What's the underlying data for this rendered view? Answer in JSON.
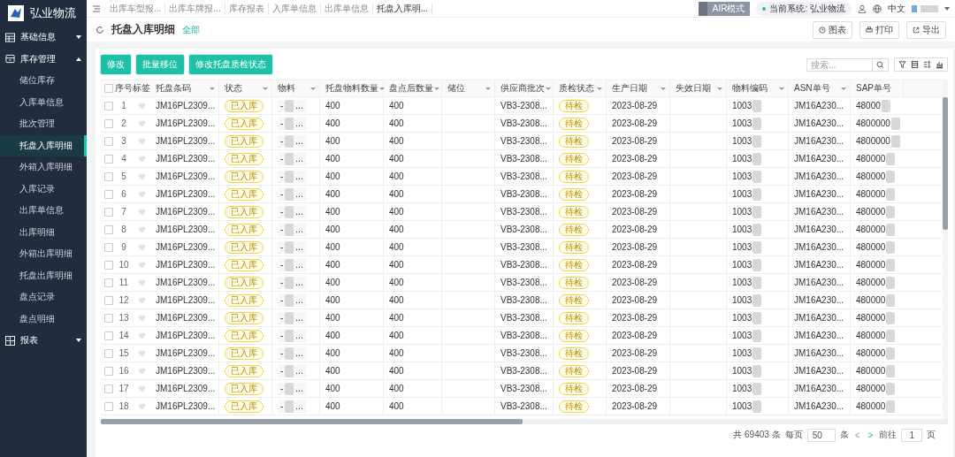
{
  "logo": {
    "title": "弘业物流"
  },
  "sidebar": {
    "groups": [
      {
        "label": "基础信息",
        "expanded": false
      },
      {
        "label": "库存管理",
        "expanded": true,
        "children": [
          {
            "label": "储位库存",
            "selected": false
          },
          {
            "label": "入库单信息",
            "selected": false
          },
          {
            "label": "批次管理",
            "selected": false
          },
          {
            "label": "托盘入库明细",
            "selected": true
          },
          {
            "label": "外箱入库明细",
            "selected": false
          },
          {
            "label": "入库记录",
            "selected": false
          },
          {
            "label": "出库单信息",
            "selected": false
          },
          {
            "label": "出库明细",
            "selected": false
          },
          {
            "label": "外箱出库明细",
            "selected": false
          },
          {
            "label": "托盘出库明细",
            "selected": false
          },
          {
            "label": "盘点记录",
            "selected": false
          },
          {
            "label": "盘点明细",
            "selected": false
          }
        ]
      },
      {
        "label": "报表",
        "expanded": false
      }
    ]
  },
  "tabs": [
    {
      "label": "出库车型报...",
      "selected": false
    },
    {
      "label": "出库车牌报...",
      "selected": false
    },
    {
      "label": "库存报表",
      "selected": false
    },
    {
      "label": "入库单信息",
      "selected": false
    },
    {
      "label": "出库单信息",
      "selected": false
    },
    {
      "label": "托盘入库明...",
      "selected": true
    }
  ],
  "topbar": {
    "mode": "AIR模式",
    "mode_on": false,
    "system": "当前系统: 弘业物流",
    "language": "中文"
  },
  "page": {
    "title": "托盘入库明细",
    "filter": "全部",
    "actions": [
      "图表",
      "打印",
      "导出"
    ]
  },
  "toolbar": {
    "buttons": [
      "修改",
      "批量移位",
      "修改托盘质检状态"
    ],
    "search": {
      "placeholder": "搜索..."
    }
  },
  "table": {
    "select_all": {
      "checked": false
    },
    "columns": [
      {
        "label": "序号",
        "dropdown": false
      },
      {
        "label": "标签",
        "dropdown": false
      },
      {
        "label": "托盘条码",
        "dropdown": true
      },
      {
        "label": "状态",
        "dropdown": true
      },
      {
        "label": "物料",
        "dropdown": true
      },
      {
        "label": "托盘物料数量",
        "dropdown": true
      },
      {
        "label": "盘点后数量",
        "dropdown": true
      },
      {
        "label": "储位",
        "dropdown": true
      },
      {
        "label": "供应商批次",
        "dropdown": true
      },
      {
        "label": "质检状态",
        "dropdown": true
      },
      {
        "label": "生产日期",
        "dropdown": true
      },
      {
        "label": "失效日期",
        "dropdown": true
      },
      {
        "label": "物料编码",
        "dropdown": true
      },
      {
        "label": "ASN单号",
        "dropdown": true
      },
      {
        "label": "SAP单号",
        "dropdown": false
      }
    ],
    "rows": [
      {
        "checked": false,
        "no": "1",
        "pallet": "JM16PL2309...",
        "status": "已入库",
        "material": "-",
        "material_tail": "...",
        "qty": "400",
        "counted": "400",
        "batch": "VB3-2308...",
        "qc": "待检",
        "date": "2023-08-29",
        "code": "1003",
        "asn": "JM16A230...",
        "sap": "48000"
      },
      {
        "checked": false,
        "no": "2",
        "pallet": "JM16PL2309...",
        "status": "已入库",
        "material": "-",
        "material_tail": "...",
        "qty": "400",
        "counted": "400",
        "batch": "VB3-2308...",
        "qc": "待检",
        "date": "2023-08-29",
        "code": "1003",
        "asn": "JM16A230...",
        "sap": "4800000"
      },
      {
        "checked": false,
        "no": "3",
        "pallet": "JM16PL2309...",
        "status": "已入库",
        "material": "-",
        "material_tail": "...",
        "qty": "400",
        "counted": "400",
        "batch": "VB3-2308...",
        "qc": "待检",
        "date": "2023-08-29",
        "code": "1003",
        "asn": "JM16A230...",
        "sap": "4800000"
      },
      {
        "checked": false,
        "no": "4",
        "pallet": "JM16PL2309...",
        "status": "已入库",
        "material": "-",
        "material_tail": "...",
        "qty": "400",
        "counted": "400",
        "batch": "VB3-2308...",
        "qc": "待检",
        "date": "2023-08-29",
        "code": "1003",
        "asn": "JM16A230...",
        "sap": "480000"
      },
      {
        "checked": false,
        "no": "5",
        "pallet": "JM16PL2309...",
        "status": "已入库",
        "material": "-",
        "material_tail": "...",
        "qty": "400",
        "counted": "400",
        "batch": "VB3-2308...",
        "qc": "待检",
        "date": "2023-08-29",
        "code": "1003",
        "asn": "JM16A230...",
        "sap": "480000"
      },
      {
        "checked": false,
        "no": "6",
        "pallet": "JM16PL2309...",
        "status": "已入库",
        "material": "-",
        "material_tail": "...",
        "qty": "400",
        "counted": "400",
        "batch": "VB3-2308...",
        "qc": "待检",
        "date": "2023-08-29",
        "code": "1003",
        "asn": "JM16A230...",
        "sap": "480000"
      },
      {
        "checked": false,
        "no": "7",
        "pallet": "JM16PL2309...",
        "status": "已入库",
        "material": "-",
        "material_tail": "...",
        "qty": "400",
        "counted": "400",
        "batch": "VB3-2308...",
        "qc": "待检",
        "date": "2023-08-29",
        "code": "1003",
        "asn": "JM16A230...",
        "sap": "480000"
      },
      {
        "checked": false,
        "no": "8",
        "pallet": "JM16PL2309...",
        "status": "已入库",
        "material": "-",
        "material_tail": "...",
        "qty": "400",
        "counted": "400",
        "batch": "VB3-2308...",
        "qc": "待检",
        "date": "2023-08-29",
        "code": "1003",
        "asn": "JM16A230...",
        "sap": "480000"
      },
      {
        "checked": false,
        "no": "9",
        "pallet": "JM16PL2309...",
        "status": "已入库",
        "material": "-",
        "material_tail": "...",
        "qty": "400",
        "counted": "400",
        "batch": "VB3-2308...",
        "qc": "待检",
        "date": "2023-08-29",
        "code": "1003",
        "asn": "JM16A230...",
        "sap": "480000"
      },
      {
        "checked": false,
        "no": "10",
        "pallet": "JM16PL2309...",
        "status": "已入库",
        "material": "-",
        "material_tail": "...",
        "qty": "400",
        "counted": "400",
        "batch": "VB3-2308...",
        "qc": "待检",
        "date": "2023-08-29",
        "code": "1003",
        "asn": "JM16A230...",
        "sap": "480000"
      },
      {
        "checked": false,
        "no": "11",
        "pallet": "JM16PL2309...",
        "status": "已入库",
        "material": "-",
        "material_tail": "...",
        "qty": "400",
        "counted": "400",
        "batch": "VB3-2308...",
        "qc": "待检",
        "date": "2023-08-29",
        "code": "1003",
        "asn": "JM16A230...",
        "sap": "480000"
      },
      {
        "checked": false,
        "no": "12",
        "pallet": "JM16PL2309...",
        "status": "已入库",
        "material": "-",
        "material_tail": "...",
        "qty": "400",
        "counted": "400",
        "batch": "VB3-2308...",
        "qc": "待检",
        "date": "2023-08-29",
        "code": "1003",
        "asn": "JM16A230...",
        "sap": "480000"
      },
      {
        "checked": false,
        "no": "13",
        "pallet": "JM16PL2309...",
        "status": "已入库",
        "material": "-",
        "material_tail": "...",
        "qty": "400",
        "counted": "400",
        "batch": "VB3-2308...",
        "qc": "待检",
        "date": "2023-08-29",
        "code": "1003",
        "asn": "JM16A230...",
        "sap": "480000"
      },
      {
        "checked": false,
        "no": "14",
        "pallet": "JM16PL2309...",
        "status": "已入库",
        "material": "-",
        "material_tail": "...",
        "qty": "400",
        "counted": "400",
        "batch": "VB3-2308...",
        "qc": "待检",
        "date": "2023-08-29",
        "code": "1003",
        "asn": "JM16A230...",
        "sap": "480000"
      },
      {
        "checked": false,
        "no": "15",
        "pallet": "JM16PL2309...",
        "status": "已入库",
        "material": "-",
        "material_tail": "...",
        "qty": "400",
        "counted": "400",
        "batch": "VB3-2308...",
        "qc": "待检",
        "date": "2023-08-29",
        "code": "1003",
        "asn": "JM16A230...",
        "sap": "480000"
      },
      {
        "checked": false,
        "no": "16",
        "pallet": "JM16PL2309...",
        "status": "已入库",
        "material": "-",
        "material_tail": "...",
        "qty": "400",
        "counted": "400",
        "batch": "VB3-2308...",
        "qc": "待检",
        "date": "2023-08-29",
        "code": "1003",
        "asn": "JM16A230...",
        "sap": "480000"
      },
      {
        "checked": false,
        "no": "17",
        "pallet": "JM16PL2309...",
        "status": "已入库",
        "material": "-",
        "material_tail": "...",
        "qty": "400",
        "counted": "400",
        "batch": "VB3-2308...",
        "qc": "待检",
        "date": "2023-08-29",
        "code": "1003",
        "asn": "JM16A230...",
        "sap": "480000"
      },
      {
        "checked": false,
        "no": "18",
        "pallet": "JM16PL2309...",
        "status": "已入库",
        "material": "-",
        "material_tail": "...",
        "qty": "400",
        "counted": "400",
        "batch": "VB3-2308...",
        "qc": "待检",
        "date": "2023-08-29",
        "code": "1003",
        "asn": "JM16A230...",
        "sap": "480000"
      }
    ]
  },
  "pagination": {
    "total": "共 69403 条",
    "per_page_label": "每页",
    "per_page": "50",
    "unit": "条",
    "prev": "<",
    "next": ">",
    "goto": "前往",
    "page": "1",
    "page_unit": "页"
  }
}
